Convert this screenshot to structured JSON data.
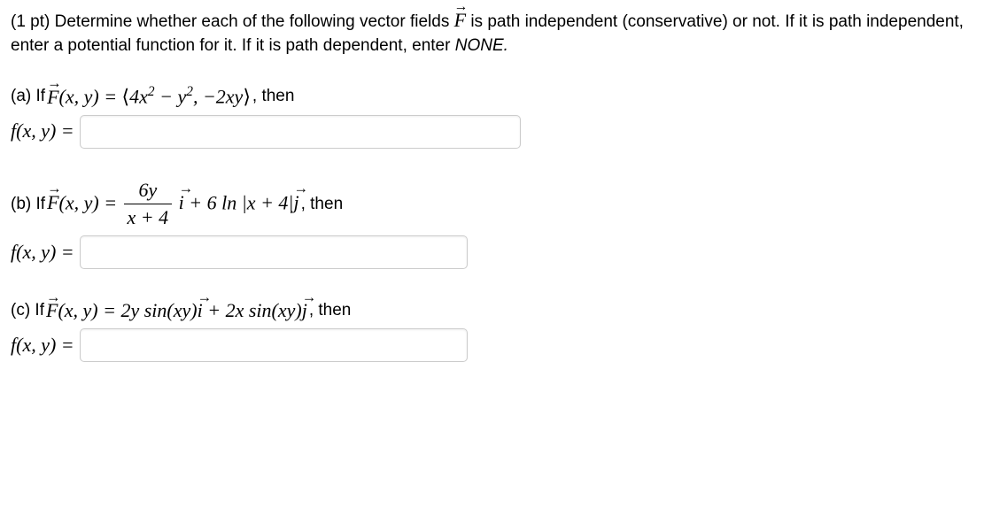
{
  "intro": {
    "points": "(1 pt)",
    "text1": " Determine whether each of the following vector fields ",
    "F": "F",
    "text2": " is path independent (conservative) or not. If it is path independent, enter a potential function for it. If it is path dependent, enter ",
    "none": "NONE.",
    "period": ""
  },
  "parts": {
    "a": {
      "label": "(a) If ",
      "Fxy": "F",
      "args": "(x, y) = ",
      "expr_open": "⟨",
      "expr_body": "4x",
      "sq": "2",
      "minus": " − y",
      "sq2": "2",
      "comma": ", −2xy",
      "expr_close": "⟩",
      "then": ", then",
      "answer_label": "f(x, y) ="
    },
    "b": {
      "label": "(b) If ",
      "Fxy": "F",
      "args": "(x, y) = ",
      "frac_num": "6y",
      "frac_den": "x + 4",
      "i": "i",
      "plus": " + 6 ln |x + 4|",
      "j": "j",
      "then": " , then",
      "answer_label": "f(x, y) ="
    },
    "c": {
      "label": "(c) If ",
      "Fxy": "F",
      "args": "(x, y) = 2y sin(xy)",
      "i": "i",
      "plus": " + 2x sin(xy)",
      "j": "j",
      "then": " , then",
      "answer_label": "f(x, y) ="
    }
  }
}
